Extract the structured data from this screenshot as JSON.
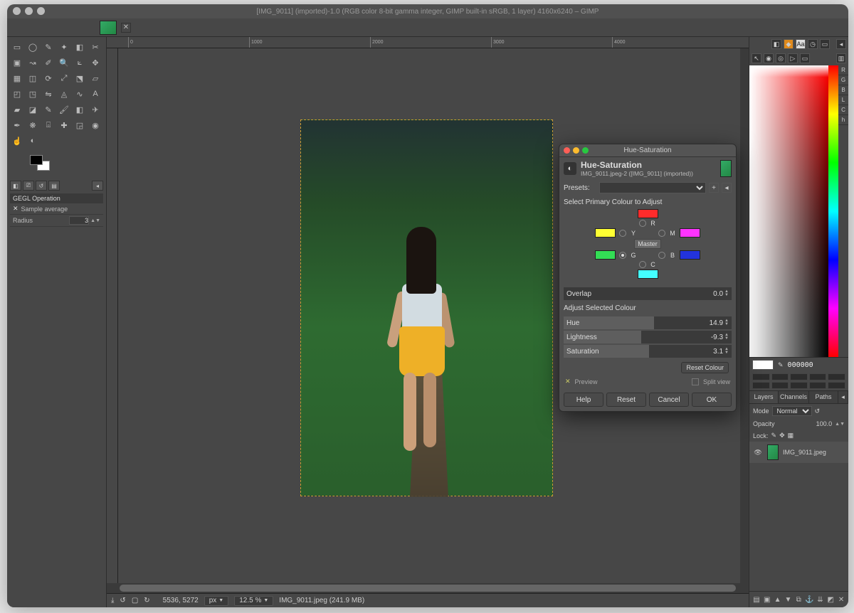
{
  "window": {
    "title": "[IMG_9011] (imported)-1.0 (RGB color 8-bit gamma integer, GIMP built-in sRGB, 1 layer) 4160x6240 – GIMP"
  },
  "tab": {
    "file": "IMG_9011.jpeg"
  },
  "tool_options": {
    "header": "GEGL Operation",
    "sample_avg": "Sample average",
    "radius_label": "Radius",
    "radius_value": "3"
  },
  "status": {
    "coords": "5536, 5272",
    "unit": "px",
    "zoom": "12.5 %",
    "file_info": "IMG_9011.jpeg (241.9 MB)"
  },
  "ruler_marks": [
    "0",
    "1000",
    "2000",
    "3000",
    "4000"
  ],
  "right": {
    "channel_labels": [
      "R",
      "G",
      "B",
      "L",
      "C",
      "h"
    ],
    "hex": "000000",
    "tabs": {
      "layers": "Layers",
      "channels": "Channels",
      "paths": "Paths"
    },
    "mode_label": "Mode",
    "mode_value": "Normal",
    "opacity_label": "Opacity",
    "opacity_value": "100.0",
    "lock_label": "Lock:",
    "layer_name": "IMG_9011.jpeg"
  },
  "dialog": {
    "title": "Hue-Saturation",
    "heading": "Hue-Saturation",
    "subheading": "IMG_9011.jpeg-2 ([IMG_9011] (imported))",
    "presets_label": "Presets:",
    "select_primary": "Select Primary Colour to Adjust",
    "master_tip": "Master",
    "channels": {
      "R": "R",
      "Y": "Y",
      "M": "M",
      "G": "G",
      "B": "B",
      "C": "C"
    },
    "colors": {
      "R": "#ff2b2b",
      "Y": "#ffff33",
      "M": "#ff33ff",
      "G": "#33dd55",
      "B": "#2233dd",
      "C": "#44ffff"
    },
    "overlap_label": "Overlap",
    "overlap_value": "0.0",
    "adjust_heading": "Adjust Selected Colour",
    "hue_label": "Hue",
    "hue_value": "14.9",
    "lightness_label": "Lightness",
    "lightness_value": "-9.3",
    "saturation_label": "Saturation",
    "saturation_value": "3.1",
    "reset_colour": "Reset Colour",
    "preview": "Preview",
    "split_view": "Split view",
    "buttons": {
      "help": "Help",
      "reset": "Reset",
      "cancel": "Cancel",
      "ok": "OK"
    }
  }
}
